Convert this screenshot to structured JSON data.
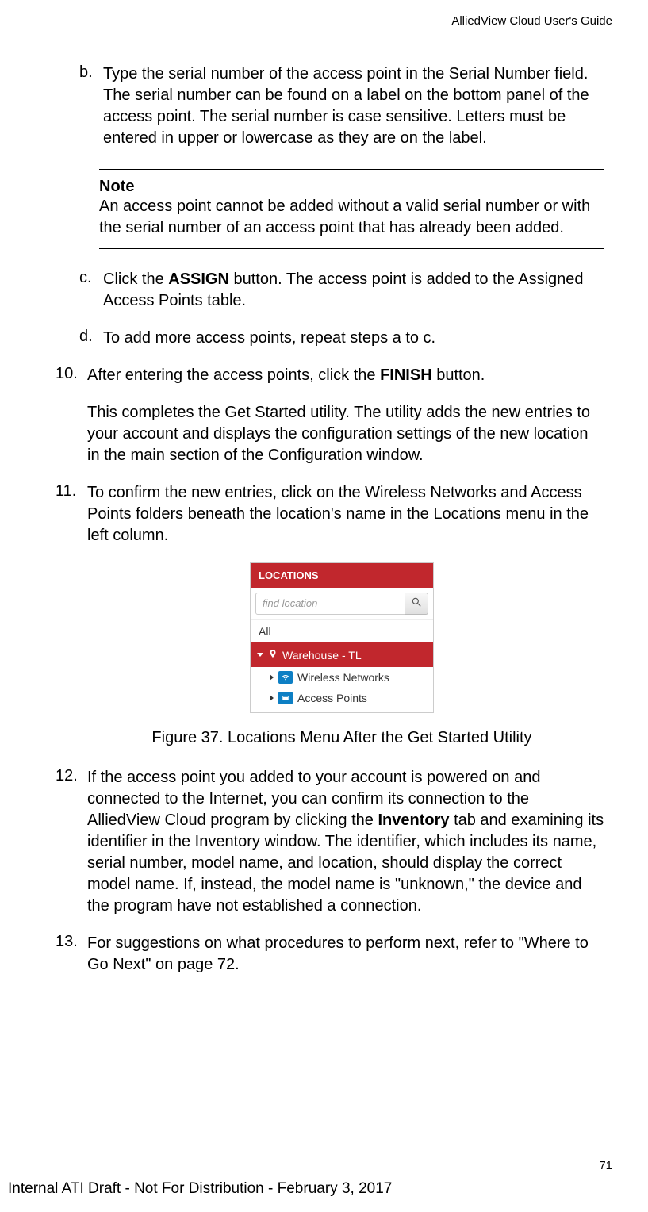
{
  "header": {
    "doc_title": "AlliedView Cloud User's Guide"
  },
  "items": {
    "b_marker": "b.",
    "b_text": "Type the serial number of the access point in the Serial Number field. The serial number can be found on a label on the bottom panel of the access point. The serial number is case sensitive. Letters must be entered in upper or lowercase as they are on the label.",
    "note_label": "Note",
    "note_text": "An access point cannot be added without a valid serial number or with the serial number of an access point that has already been added.",
    "c_marker": "c.",
    "c_text_pre": "Click the ",
    "c_bold": "ASSIGN",
    "c_text_post": " button. The access point is added to the Assigned Access Points table.",
    "d_marker": "d.",
    "d_text": "To add more access points, repeat steps a to c.",
    "n10_marker": "10.",
    "n10_text_pre": "After entering the access points, click the ",
    "n10_bold": "FINISH",
    "n10_text_post": " button.",
    "n10_para": "This completes the Get Started utility. The utility adds the new entries to your account and displays the configuration settings of the new location in the main section of the Configuration window.",
    "n11_marker": "11.",
    "n11_text": "To confirm the new entries, click on the Wireless Networks and Access Points folders beneath the location's name in the Locations menu in the left column.",
    "n12_marker": "12.",
    "n12_text_pre": "If the access point you added to your account is powered on and connected to the Internet, you can confirm its connection to the AlliedView Cloud program by clicking the ",
    "n12_bold": "Inventory",
    "n12_text_post": " tab and examining its identifier in the Inventory window. The identifier, which includes its name, serial number, model name, and location, should display the correct model name. If, instead, the model name is \"unknown,\" the device and the program have not established a connection.",
    "n13_marker": "13.",
    "n13_text": "For suggestions on what procedures to perform next, refer to \"Where to Go Next\" on page 72."
  },
  "widget": {
    "title": "LOCATIONS",
    "search_placeholder": "find location",
    "all_label": "All",
    "location_name": "Warehouse - TL",
    "sub1": "Wireless Networks",
    "sub2": "Access Points"
  },
  "figure_caption": "Figure 37. Locations Menu After the Get Started Utility",
  "page_number": "71",
  "footer": "Internal ATI Draft - Not For Distribution - February 3, 2017"
}
